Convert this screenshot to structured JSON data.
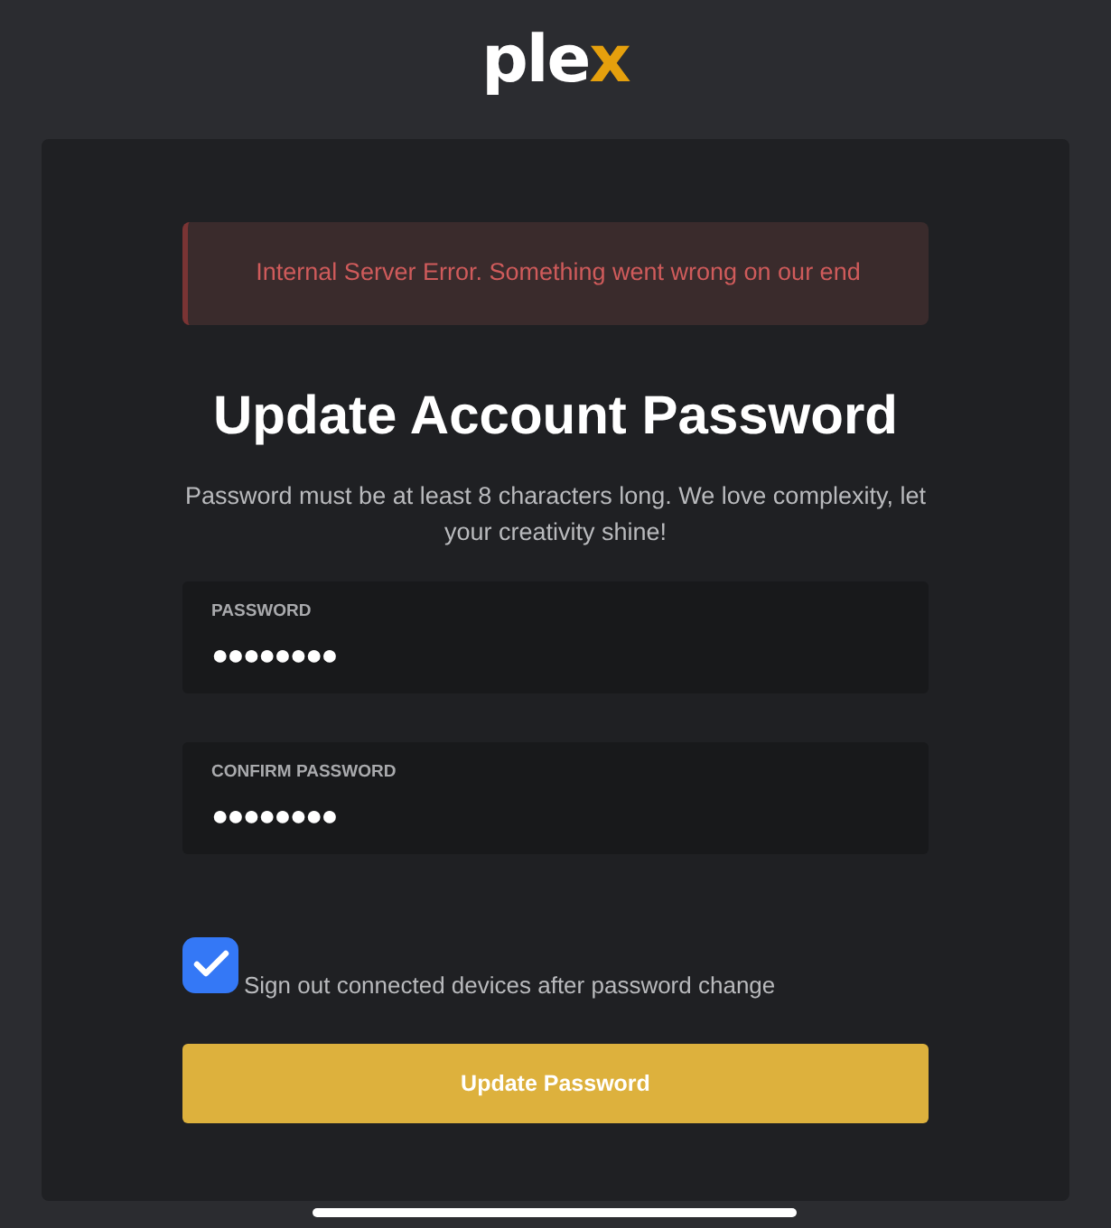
{
  "logo": {
    "main": "ple",
    "accent": "x"
  },
  "alert": {
    "message": "Internal Server Error. Something went wrong on our end"
  },
  "title": "Update Account Password",
  "description": "Password must be at least 8 characters long. We love complexity, let your creativity shine!",
  "fields": [
    {
      "label": "PASSWORD",
      "value": "●●●●●●●●"
    },
    {
      "label": "CONFIRM PASSWORD",
      "value": "●●●●●●●●"
    }
  ],
  "checkbox": {
    "label": "Sign out connected devices after password change",
    "checked": true
  },
  "button": {
    "label": "Update Password"
  }
}
